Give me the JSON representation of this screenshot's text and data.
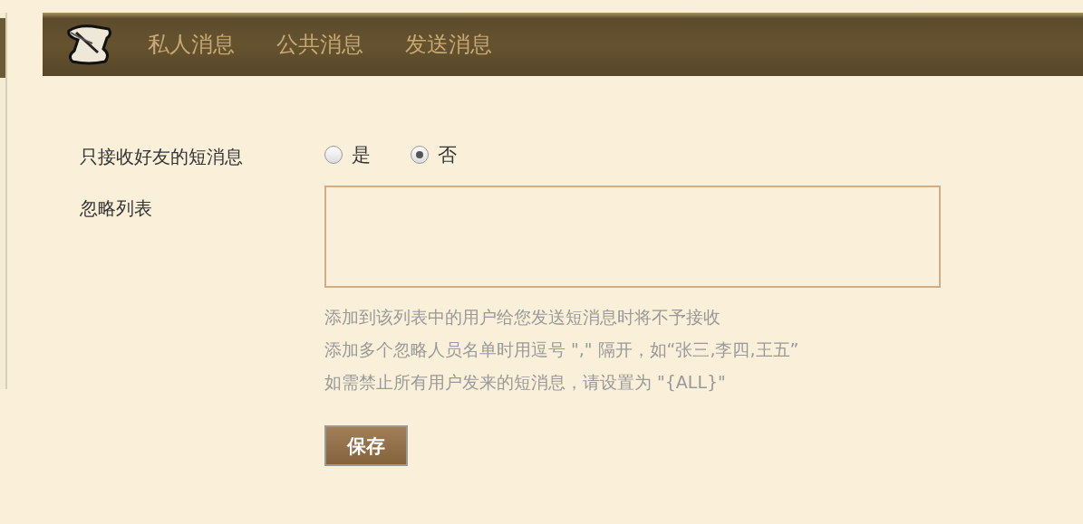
{
  "tabs": [
    {
      "label": "私人消息"
    },
    {
      "label": "公共消息"
    },
    {
      "label": "发送消息"
    }
  ],
  "friends_only": {
    "label": "只接收好友的短消息",
    "options": [
      {
        "label": "是",
        "selected": false
      },
      {
        "label": "否",
        "selected": true
      }
    ]
  },
  "ignore_list": {
    "label": "忽略列表",
    "hints": [
      "添加到该列表中的用户给您发送短消息时将不予接收",
      "添加多个忽略人员名单时用逗号 \",\" 隔开，如“张三,李四,王五”",
      "如需禁止所有用户发来的短消息，请设置为 \"{ALL}\""
    ]
  },
  "save_button": "保存"
}
